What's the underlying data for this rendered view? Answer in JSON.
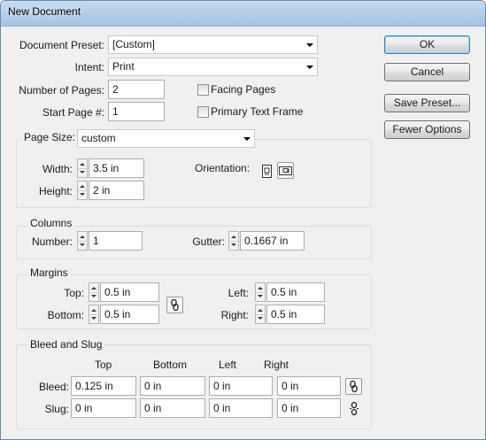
{
  "window": {
    "title": "New Document"
  },
  "preset": {
    "label": "Document Preset:",
    "value": "[Custom]"
  },
  "intent": {
    "label": "Intent:",
    "value": "Print"
  },
  "pages": {
    "number_label": "Number of Pages:",
    "number_value": "2",
    "start_label": "Start Page #:",
    "start_value": "1"
  },
  "options": {
    "facing_pages": "Facing Pages",
    "primary_text_frame": "Primary Text Frame"
  },
  "page_size": {
    "label": "Page Size:",
    "value": "custom",
    "width_label": "Width:",
    "width_value": "3.5 in",
    "height_label": "Height:",
    "height_value": "2 in",
    "orientation_label": "Orientation:"
  },
  "columns": {
    "title": "Columns",
    "number_label": "Number:",
    "number_value": "1",
    "gutter_label": "Gutter:",
    "gutter_value": "0.1667 in"
  },
  "margins": {
    "title": "Margins",
    "top_label": "Top:",
    "top_value": "0.5 in",
    "bottom_label": "Bottom:",
    "bottom_value": "0.5 in",
    "left_label": "Left:",
    "left_value": "0.5 in",
    "right_label": "Right:",
    "right_value": "0.5 in"
  },
  "bleed_slug": {
    "title": "Bleed and Slug",
    "col_top": "Top",
    "col_bottom": "Bottom",
    "col_left": "Left",
    "col_right": "Right",
    "bleed_label": "Bleed:",
    "bleed": [
      "0.125 in",
      "0 in",
      "0 in",
      "0 in"
    ],
    "slug_label": "Slug:",
    "slug": [
      "0 in",
      "0 in",
      "0 in",
      "0 in"
    ]
  },
  "buttons": {
    "ok": "OK",
    "cancel": "Cancel",
    "save_preset": "Save Preset...",
    "fewer_options": "Fewer Options"
  }
}
